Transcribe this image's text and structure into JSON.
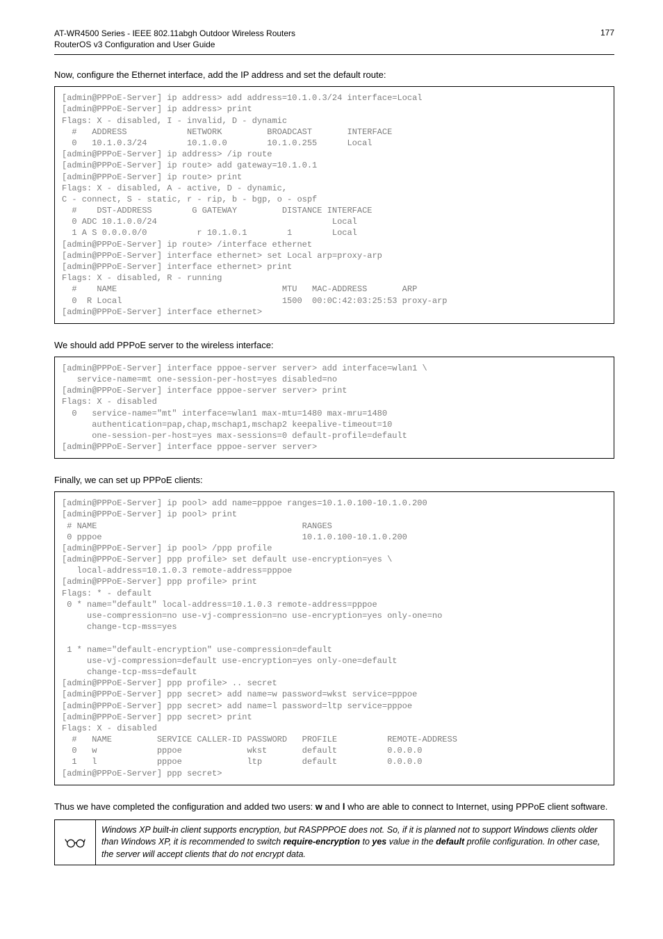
{
  "header": {
    "line1": "AT-WR4500 Series - IEEE 802.11abgh Outdoor Wireless Routers",
    "line2": "RouterOS v3 Configuration and User Guide",
    "page_number": "177"
  },
  "section1": {
    "intro": "Now, configure the Ethernet interface, add the IP address and set the default route:",
    "code": "[admin@PPPoE-Server] ip address> add address=10.1.0.3/24 interface=Local\n[admin@PPPoE-Server] ip address> print\nFlags: X - disabled, I - invalid, D - dynamic\n  #   ADDRESS            NETWORK         BROADCAST       INTERFACE\n  0   10.1.0.3/24        10.1.0.0        10.1.0.255      Local\n[admin@PPPoE-Server] ip address> /ip route\n[admin@PPPoE-Server] ip route> add gateway=10.1.0.1\n[admin@PPPoE-Server] ip route> print\nFlags: X - disabled, A - active, D - dynamic,\nC - connect, S - static, r - rip, b - bgp, o - ospf\n  #    DST-ADDRESS        G GATEWAY         DISTANCE INTERFACE\n  0 ADC 10.1.0.0/24                                   Local\n  1 A S 0.0.0.0/0          r 10.1.0.1        1        Local\n[admin@PPPoE-Server] ip route> /interface ethernet\n[admin@PPPoE-Server] interface ethernet> set Local arp=proxy-arp\n[admin@PPPoE-Server] interface ethernet> print\nFlags: X - disabled, R - running\n  #    NAME                                 MTU   MAC-ADDRESS       ARP\n  0  R Local                                1500  00:0C:42:03:25:53 proxy-arp\n[admin@PPPoE-Server] interface ethernet>"
  },
  "section2": {
    "intro": "We should add PPPoE server to the wireless interface:",
    "code": "[admin@PPPoE-Server] interface pppoe-server server> add interface=wlan1 \\\n   service-name=mt one-session-per-host=yes disabled=no\n[admin@PPPoE-Server] interface pppoe-server server> print\nFlags: X - disabled\n  0   service-name=\"mt\" interface=wlan1 max-mtu=1480 max-mru=1480\n      authentication=pap,chap,mschap1,mschap2 keepalive-timeout=10\n      one-session-per-host=yes max-sessions=0 default-profile=default\n[admin@PPPoE-Server] interface pppoe-server server>"
  },
  "section3": {
    "intro": "Finally, we can set up PPPoE clients:",
    "code": "[admin@PPPoE-Server] ip pool> add name=pppoe ranges=10.1.0.100-10.1.0.200\n[admin@PPPoE-Server] ip pool> print\n # NAME                                         RANGES\n 0 pppoe                                        10.1.0.100-10.1.0.200\n[admin@PPPoE-Server] ip pool> /ppp profile\n[admin@PPPoE-Server] ppp profile> set default use-encryption=yes \\\n   local-address=10.1.0.3 remote-address=pppoe\n[admin@PPPoE-Server] ppp profile> print\nFlags: * - default\n 0 * name=\"default\" local-address=10.1.0.3 remote-address=pppoe\n     use-compression=no use-vj-compression=no use-encryption=yes only-one=no\n     change-tcp-mss=yes\n\n 1 * name=\"default-encryption\" use-compression=default\n     use-vj-compression=default use-encryption=yes only-one=default\n     change-tcp-mss=default\n[admin@PPPoE-Server] ppp profile> .. secret\n[admin@PPPoE-Server] ppp secret> add name=w password=wkst service=pppoe\n[admin@PPPoE-Server] ppp secret> add name=l password=ltp service=pppoe\n[admin@PPPoE-Server] ppp secret> print\nFlags: X - disabled\n  #   NAME         SERVICE CALLER-ID PASSWORD   PROFILE          REMOTE-ADDRESS\n  0   w            pppoe             wkst       default          0.0.0.0\n  1   l            pppoe             ltp        default          0.0.0.0\n[admin@PPPoE-Server] ppp secret>"
  },
  "closing_para": {
    "p1a": "Thus we have completed the configuration and added two users: ",
    "w": "w",
    "p1b": " and ",
    "l": "l",
    "p1c": " who are able to connect to Internet, using PPPoE client software."
  },
  "note": {
    "t1": "Windows XP built-in client supports encryption, but RASPPPOE does not. So, if it is planned not to support Windows clients older than Windows XP, it is recommended to switch ",
    "b1": "require-encryption",
    "t2": " to ",
    "b2": "yes",
    "t3": " value in the ",
    "b3": "default",
    "t4": " profile configuration. In other case, the server will accept clients that do not encrypt data."
  }
}
